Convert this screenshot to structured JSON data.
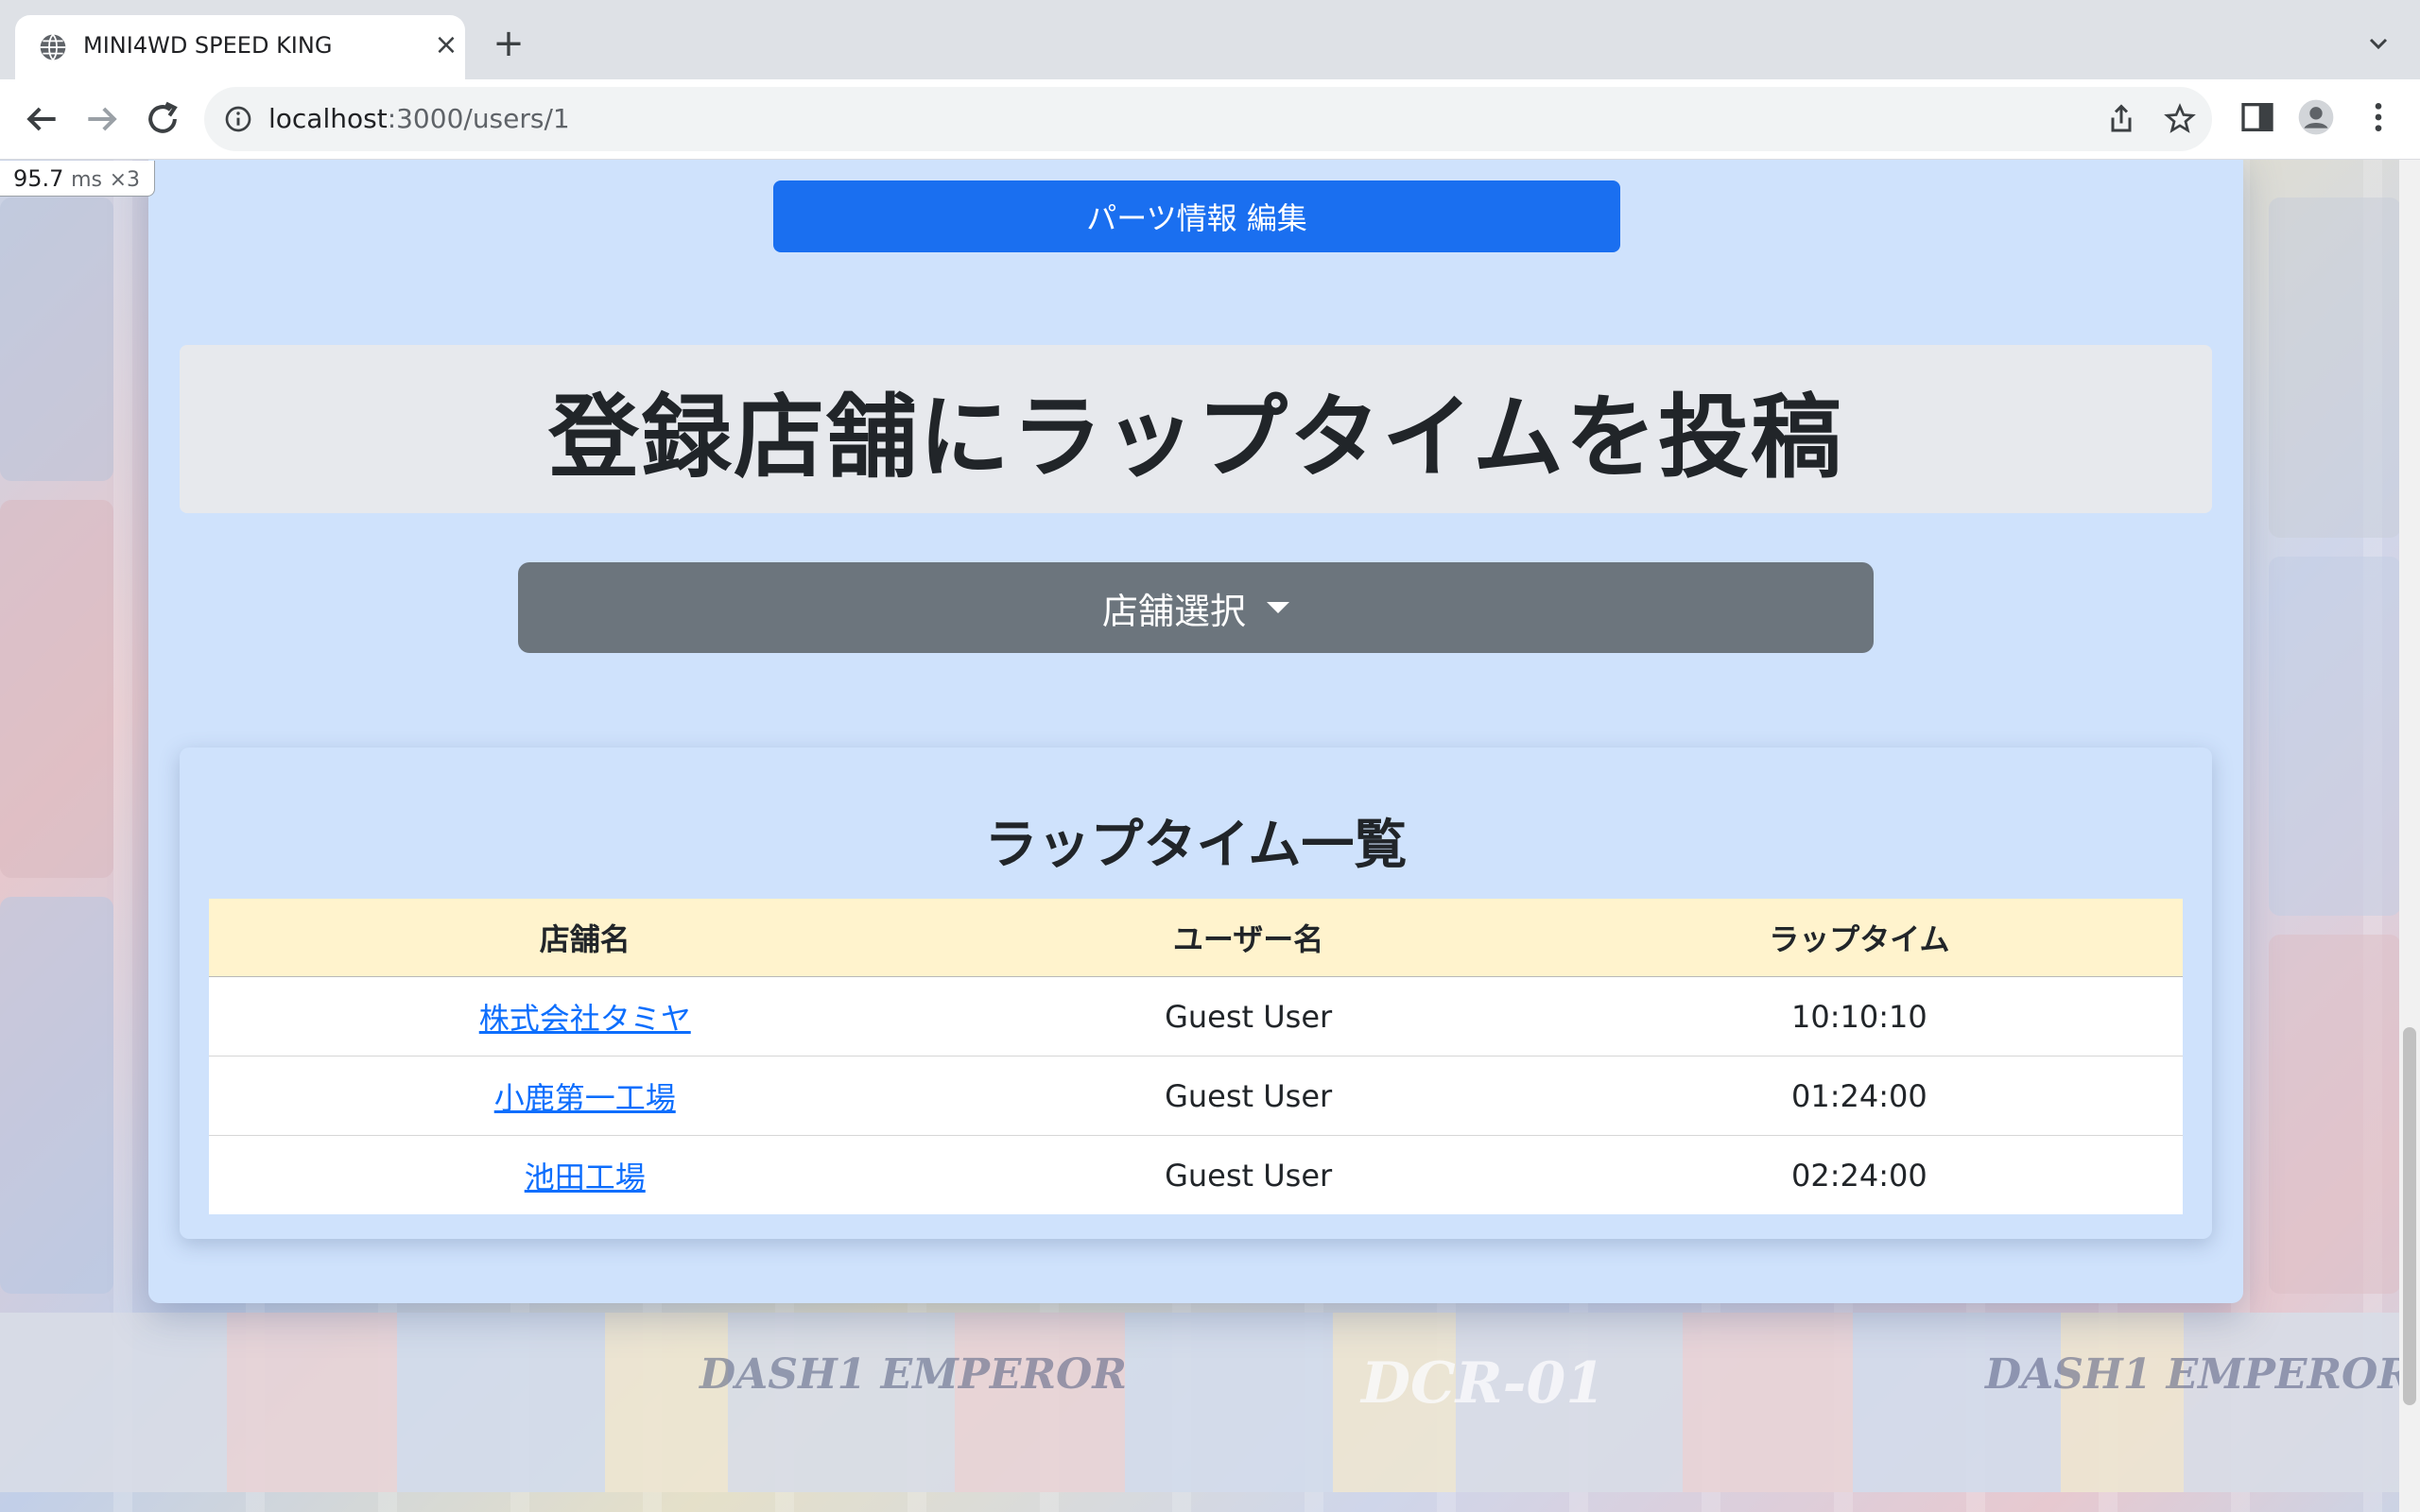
{
  "browser": {
    "tab_title": "MINI4WD SPEED KING",
    "url_host": "localhost",
    "url_path": ":3000/users/1",
    "icons": [
      "globe-icon",
      "close-icon",
      "plus-icon",
      "chevron-down-icon",
      "back-arrow-icon",
      "forward-arrow-icon",
      "reload-icon",
      "info-icon",
      "share-icon",
      "star-icon",
      "sidebar-icon",
      "profile-icon",
      "kebab-menu-icon"
    ]
  },
  "perf_overlay": {
    "value": "95.7",
    "unit": "ms",
    "multiplier": "×3"
  },
  "page": {
    "edit_parts_button": "パーツ情報 編集",
    "hero_title": "登録店舗にラップタイムを投稿",
    "shop_select": {
      "label": "店舗選択"
    },
    "lap_list": {
      "heading": "ラップタイム一覧",
      "columns": [
        "店舗名",
        "ユーザー名",
        "ラップタイム"
      ],
      "rows": [
        {
          "shop": "株式会社タミヤ",
          "user": "Guest User",
          "lap": "10:10:10"
        },
        {
          "shop": "小鹿第一工場",
          "user": "Guest User",
          "lap": "01:24:00"
        },
        {
          "shop": "池田工場",
          "user": "Guest User",
          "lap": "02:24:00"
        }
      ]
    }
  },
  "background_labels": [
    "DASH1 EMPEROR",
    "DCR-01",
    "DASH1 EMPEROR"
  ],
  "colors": {
    "primary": "#1a6ff0",
    "secondary": "#6c757d",
    "card_bg": "#cfe2fc",
    "table_header_bg": "#fff3cd",
    "link": "#0d6efd"
  }
}
